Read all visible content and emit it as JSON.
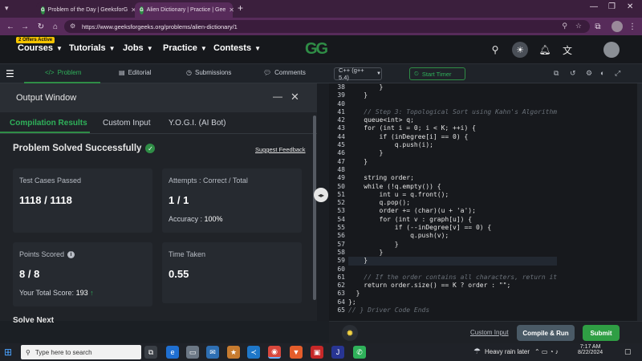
{
  "browser": {
    "tabs": [
      {
        "label": "Problem of the Day | GeeksforG",
        "active": false
      },
      {
        "label": "Alien Dictionary | Practice | Gee",
        "active": true
      }
    ],
    "url": "https://www.geeksforgeeks.org/problems/alien-dictionary/1"
  },
  "gfg_header": {
    "offers_badge": "2 Offers Active",
    "nav": [
      "Courses",
      "Tutorials",
      "Jobs",
      "Practice",
      "Contests"
    ],
    "logo_text": "GG"
  },
  "problem_tabs": {
    "problem": "Problem",
    "editorial": "Editorial",
    "submissions": "Submissions",
    "comments": "Comments"
  },
  "output_window": {
    "title": "Output Window",
    "tabs": [
      "Compilation Results",
      "Custom Input",
      "Y.O.G.I. (AI Bot)"
    ],
    "status": "Problem Solved Successfully",
    "suggest_feedback": "Suggest Feedback",
    "test_cases_label": "Test Cases Passed",
    "test_cases_value": "1118 / 1118",
    "attempts_label": "Attempts : Correct / Total",
    "attempts_value": "1 / 1",
    "accuracy_label": "Accuracy :",
    "accuracy_value": "100%",
    "points_label": "Points Scored",
    "points_value": "8 / 8",
    "total_score_label": "Your Total Score:",
    "total_score_value": "193",
    "time_label": "Time Taken",
    "time_value": "0.55",
    "solve_next": "Solve Next"
  },
  "editor": {
    "language": "C++ (g++ 5.4)",
    "timer": "Start Timer",
    "lines": [
      {
        "n": "38",
        "code": "        }"
      },
      {
        "n": "39",
        "code": "    }"
      },
      {
        "n": "40",
        "code": ""
      },
      {
        "n": "41",
        "code": "    // Step 3: Topological Sort using Kahn's Algorithm"
      },
      {
        "n": "42",
        "code": "    queue<int> q;"
      },
      {
        "n": "43",
        "code": "    for (int i = 0; i < K; ++i) {"
      },
      {
        "n": "44",
        "code": "        if (inDegree[i] == 0) {"
      },
      {
        "n": "45",
        "code": "            q.push(i);"
      },
      {
        "n": "46",
        "code": "        }"
      },
      {
        "n": "47",
        "code": "    }"
      },
      {
        "n": "48",
        "code": ""
      },
      {
        "n": "49",
        "code": "    string order;"
      },
      {
        "n": "50",
        "code": "    while (!q.empty()) {"
      },
      {
        "n": "51",
        "code": "        int u = q.front();"
      },
      {
        "n": "52",
        "code": "        q.pop();"
      },
      {
        "n": "53",
        "code": "        order += (char)(u + 'a');"
      },
      {
        "n": "54",
        "code": "        for (int v : graph[u]) {"
      },
      {
        "n": "55",
        "code": "            if (--inDegree[v] == 0) {"
      },
      {
        "n": "56",
        "code": "                q.push(v);"
      },
      {
        "n": "57",
        "code": "            }"
      },
      {
        "n": "58",
        "code": "        }"
      },
      {
        "n": "59",
        "code": "    }"
      },
      {
        "n": "60",
        "code": ""
      },
      {
        "n": "61",
        "code": "    // If the order contains all characters, return it"
      },
      {
        "n": "62",
        "code": "    return order.size() == K ? order : \"\";"
      },
      {
        "n": "63",
        "code": "  }"
      },
      {
        "n": "64",
        "code": "};"
      },
      {
        "n": "65",
        "code": "// } Driver Code Ends"
      }
    ],
    "custom_input": "Custom Input",
    "compile_run": "Compile & Run",
    "submit": "Submit"
  },
  "taskbar": {
    "search_placeholder": "Type here to search",
    "weather": "Heavy rain later",
    "time": "7:17 AM",
    "date": "8/22/2024"
  },
  "colors": {
    "gfg_green": "#2f8d46",
    "submit_green": "#2f9e44",
    "accent_blue": "#1f6fd1"
  }
}
